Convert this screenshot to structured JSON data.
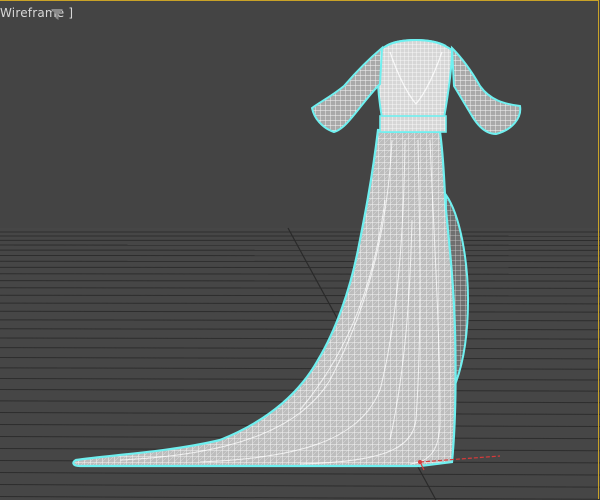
{
  "viewport": {
    "label": "Wireframe ]",
    "icons": [
      "filter-icon"
    ],
    "colors": {
      "background": "#444444",
      "grid_line": "#2e2e2e",
      "mesh": "#f2f2f2",
      "selection_outline": "#6ff0f0",
      "pivot_axis_x": "#d83a3a",
      "border_highlight": "#c9a227"
    }
  },
  "scene": {
    "object": "dress-wireframe-mesh",
    "selected": true
  }
}
